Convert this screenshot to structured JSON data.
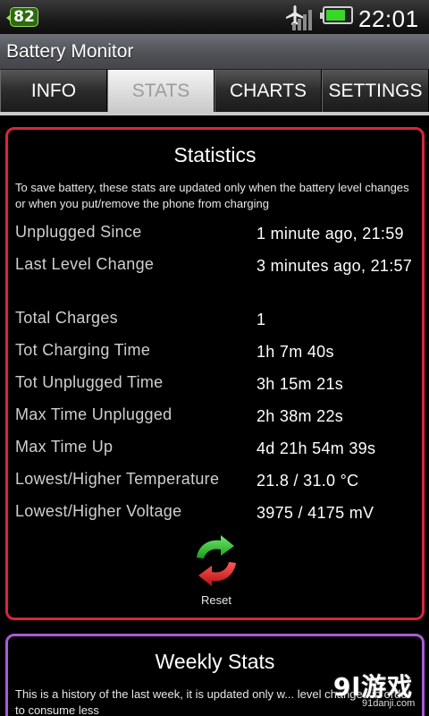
{
  "status_bar": {
    "notification_count": "82",
    "icons": [
      "airplane-mode-icon",
      "signal-icon",
      "battery-icon"
    ],
    "time": "22:01",
    "battery_level": 0.8
  },
  "app_title": "Battery Monitor",
  "tabs": [
    {
      "label": "INFO",
      "active": false
    },
    {
      "label": "STATS",
      "active": true
    },
    {
      "label": "CHARTS",
      "active": false
    },
    {
      "label": "SETTINGS",
      "active": false
    }
  ],
  "statistics": {
    "title": "Statistics",
    "note": "To save battery, these stats are updated only when the battery level changes or when you put/remove the phone from charging",
    "rows": [
      {
        "label": "Unplugged Since",
        "value": "1 minute ago, 21:59"
      },
      {
        "label": "Last Level Change",
        "value": "3 minutes ago, 21:57"
      },
      {
        "label": "Total Charges",
        "value": "1"
      },
      {
        "label": "Tot Charging Time",
        "value": "1h 7m 40s"
      },
      {
        "label": "Tot Unplugged Time",
        "value": "3h 15m 21s"
      },
      {
        "label": "Max Time Unplugged",
        "value": "2h 38m 22s"
      },
      {
        "label": "Max Time Up",
        "value": "4d 21h 54m 39s"
      },
      {
        "label": "Lowest/Higher Temperature",
        "value": "21.8 / 31.0 °C"
      },
      {
        "label": "Lowest/Higher Voltage",
        "value": "3975 / 4175 mV"
      }
    ],
    "reset_label": "Reset"
  },
  "weekly": {
    "title": "Weekly Stats",
    "note": "This is a history of the last week, it is updated only w... level changes in order to consume less"
  },
  "watermark": {
    "logo": "9l游戏",
    "url": "91danji.com"
  },
  "colors": {
    "stats_border": "#d7263d",
    "weekly_border": "#a85cd6",
    "reset_green": "#2ec12e",
    "reset_red": "#e02020"
  }
}
